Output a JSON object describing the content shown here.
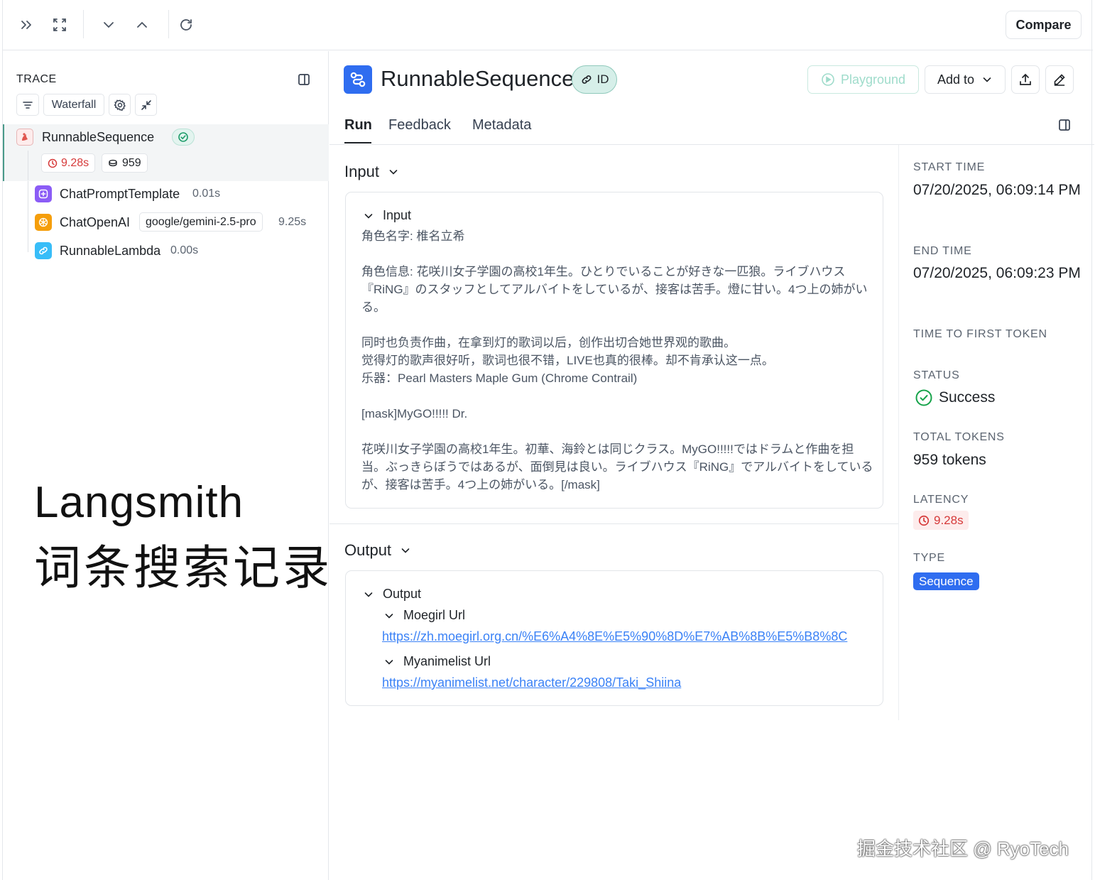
{
  "toolbar": {
    "compare_label": "Compare"
  },
  "trace": {
    "title": "TRACE",
    "view_label": "Waterfall",
    "root": {
      "label": "RunnableSequence",
      "latency": "9.28s",
      "tokens": "959"
    },
    "children": [
      {
        "label": "ChatPromptTemplate",
        "meta": "0.01s"
      },
      {
        "label": "ChatOpenAI",
        "model": "google/gemini-2.5-pro",
        "meta": "9.25s"
      },
      {
        "label": "RunnableLambda",
        "meta": "0.00s"
      }
    ]
  },
  "overlay": {
    "title": "Langsmith",
    "subtitle": "词条搜索记录",
    "watermark": "掘金技术社区 @ RyoTech"
  },
  "run": {
    "title": "RunnableSequence",
    "id_label": "ID",
    "playground_label": "Playground",
    "add_to_label": "Add to",
    "tabs": [
      "Run",
      "Feedback",
      "Metadata"
    ]
  },
  "input": {
    "section_title": "Input",
    "card_title": "Input",
    "text": "角色名字: 椎名立希\n\n角色信息: 花咲川女子学園の高校1年生。ひとりでいることが好きな一匹狼。ライブハウス『RiNG』のスタッフとしてアルバイトをしているが、接客は苦手。燈に甘い。4つ上の姉がいる。\n\n同时也负责作曲，在拿到灯的歌词以后，创作出切合她世界观的歌曲。\n觉得灯的歌声很好听，歌词也很不错，LIVE也真的很棒。却不肯承认这一点。\n乐器：Pearl Masters Maple Gum (Chrome Contrail)\n\n[mask]MyGO!!!!! Dr.\n\n花咲川女子学園の高校1年生。初華、海鈴とは同じクラス。MyGO!!!!!ではドラムと作曲を担当。ぶっきらぼうではあるが、面倒見は良い。ライブハウス『RiNG』でアルバイトをしているが、接客は苦手。4つ上の姉がいる。[/mask]"
  },
  "output": {
    "section_title": "Output",
    "card_title": "Output",
    "moegirl_label": "Moegirl Url",
    "moegirl_url": "https://zh.moegirl.org.cn/%E6%A4%8E%E5%90%8D%E7%AB%8B%E5%B8%8C",
    "mal_label": "Myanimelist Url",
    "mal_url": "https://myanimelist.net/character/229808/Taki_Shiina"
  },
  "meta": {
    "start_label": "START TIME",
    "start_value": "07/20/2025, 06:09:14 PM",
    "end_label": "END TIME",
    "end_value": "07/20/2025, 06:09:23 PM",
    "ttft_label": "TIME TO FIRST TOKEN",
    "status_label": "STATUS",
    "status_value": "Success",
    "tokens_label": "TOTAL TOKENS",
    "tokens_value": "959 tokens",
    "latency_label": "LATENCY",
    "latency_value": "9.28s",
    "type_label": "TYPE",
    "type_value": "Sequence"
  },
  "colors": {
    "accent": "#2f6df0",
    "success": "#16a34a",
    "latency": "#d63a3a",
    "link": "#3b82f6"
  }
}
